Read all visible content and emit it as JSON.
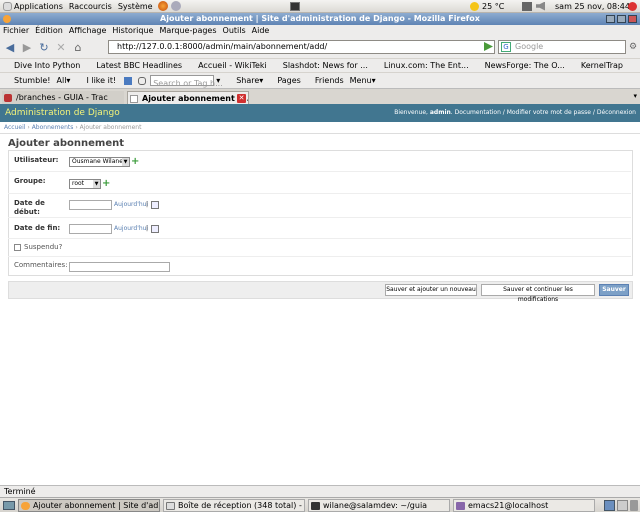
{
  "panel": {
    "menus": [
      "Applications",
      "Raccourcis",
      "Système"
    ],
    "weather": "25 °C",
    "datetime": "sam 25 nov, 08:44"
  },
  "window": {
    "title": "Ajouter abonnement | Site d'administration de Django - Mozilla Firefox"
  },
  "menubar": [
    "Fichier",
    "Édition",
    "Affichage",
    "Historique",
    "Marque-pages",
    "Outils",
    "Aide"
  ],
  "nav": {
    "url": "http://127.0.0.1:8000/admin/main/abonnement/add/",
    "search_placeholder": "Google"
  },
  "bookmarks": [
    "Dive Into Python",
    "Latest BBC Headlines",
    "Accueil - WikiTeki",
    "Slashdot: News for ...",
    "Linux.com: The Ent...",
    "NewsForge: The O...",
    "KernelTrap"
  ],
  "stumble": {
    "items": [
      "Stumble!",
      "All▾",
      "I like it!"
    ],
    "search_placeholder": "Search or Tag h...",
    "right_items": [
      "Share▾",
      "Pages",
      "Friends",
      "Menu▾"
    ]
  },
  "tabs": [
    {
      "label": "/branches - GUIA - Trac",
      "active": false
    },
    {
      "label": "Ajouter abonnement |...",
      "active": true
    }
  ],
  "django": {
    "site_title": "Administration de Django",
    "user_tools_welcome": "Bienvenue,",
    "user_name": "admin",
    "user_tools_links": ". Documentation / Modifier votre mot de passe / Déconnexion",
    "breadcrumb_home": "Accueil",
    "breadcrumb_model": "Abonnements",
    "breadcrumb_current": "Ajouter abonnement",
    "breadcrumb_sep": "›",
    "page_title": "Ajouter abonnement",
    "fields": {
      "utilisateur_label": "Utilisateur:",
      "utilisateur_value": "Ousmane Wilane",
      "groupe_label": "Groupe:",
      "groupe_value": "root",
      "date_debut_label": "Date de début:",
      "date_fin_label": "Date de fin:",
      "today_link": "Aujourd'hui",
      "link_sep": "|",
      "suspendu_label": "Suspendu?",
      "commentaires_label": "Commentaires:"
    },
    "buttons": {
      "save_add": "Sauver et ajouter un nouveau",
      "save_continue": "Sauver et continuer les modifications",
      "save": "Sauver"
    }
  },
  "status": "Terminé",
  "taskbar": [
    {
      "label": "Ajouter abonnement | Site d'ad...",
      "active": true
    },
    {
      "label": "Boîte de réception (348 total) - ...",
      "active": false
    },
    {
      "label": "wilane@salamdev: ~/guia",
      "active": false
    },
    {
      "label": "emacs21@localhost",
      "active": false
    }
  ],
  "colors": {
    "django_header": "#417690",
    "django_title": "#f4f379",
    "link": "#5b80b2"
  }
}
